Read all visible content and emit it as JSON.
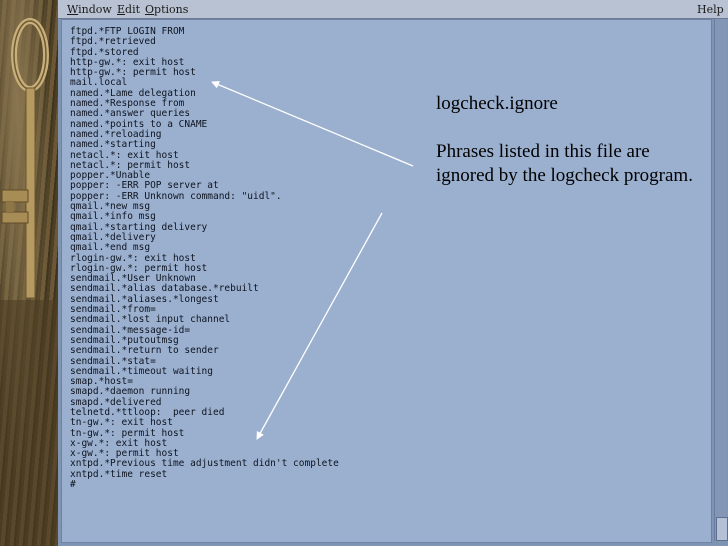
{
  "menubar": {
    "items": [
      {
        "label": "Window",
        "underline": "W"
      },
      {
        "label": "Edit",
        "underline": "E"
      },
      {
        "label": "Options",
        "underline": "O"
      }
    ],
    "help_label": "Help"
  },
  "log_lines": [
    "ftpd.*FTP LOGIN FROM",
    "ftpd.*retrieved",
    "ftpd.*stored",
    "http-gw.*: exit host",
    "http-gw.*: permit host",
    "mail.local",
    "named.*Lame delegation",
    "named.*Response from",
    "named.*answer queries",
    "named.*points to a CNAME",
    "named.*reloading",
    "named.*starting",
    "netacl.*: exit host",
    "netacl.*: permit host",
    "popper.*Unable",
    "popper: -ERR POP server at",
    "popper: -ERR Unknown command: \"uidl\".",
    "qmail.*new msg",
    "qmail.*info msg",
    "qmail.*starting delivery",
    "qmail.*delivery",
    "qmail.*end msg",
    "rlogin-gw.*: exit host",
    "rlogin-gw.*: permit host",
    "sendmail.*User Unknown",
    "sendmail.*alias database.*rebuilt",
    "sendmail.*aliases.*longest",
    "sendmail.*from=",
    "sendmail.*lost input channel",
    "sendmail.*message-id=",
    "sendmail.*putoutmsg",
    "sendmail.*return to sender",
    "sendmail.*stat=",
    "sendmail.*timeout waiting",
    "smap.*host=",
    "smapd.*daemon running",
    "smapd.*delivered",
    "telnetd.*ttloop:  peer died",
    "tn-gw.*: exit host",
    "tn-gw.*: permit host",
    "x-gw.*: exit host",
    "x-gw.*: permit host",
    "xntpd.*Previous time adjustment didn't complete",
    "xntpd.*time reset",
    "#"
  ],
  "note": {
    "title": "logcheck.ignore",
    "body": "Phrases listed in this file are ignored by the logcheck program."
  },
  "colors": {
    "window_bg": "#7f93b3",
    "content_bg": "#9bb0cf",
    "menubar_bg": "#b9c2d2",
    "arrow": "#ffffff"
  },
  "icons": {
    "arrow": "arrow-icon",
    "key": "key-photo"
  }
}
